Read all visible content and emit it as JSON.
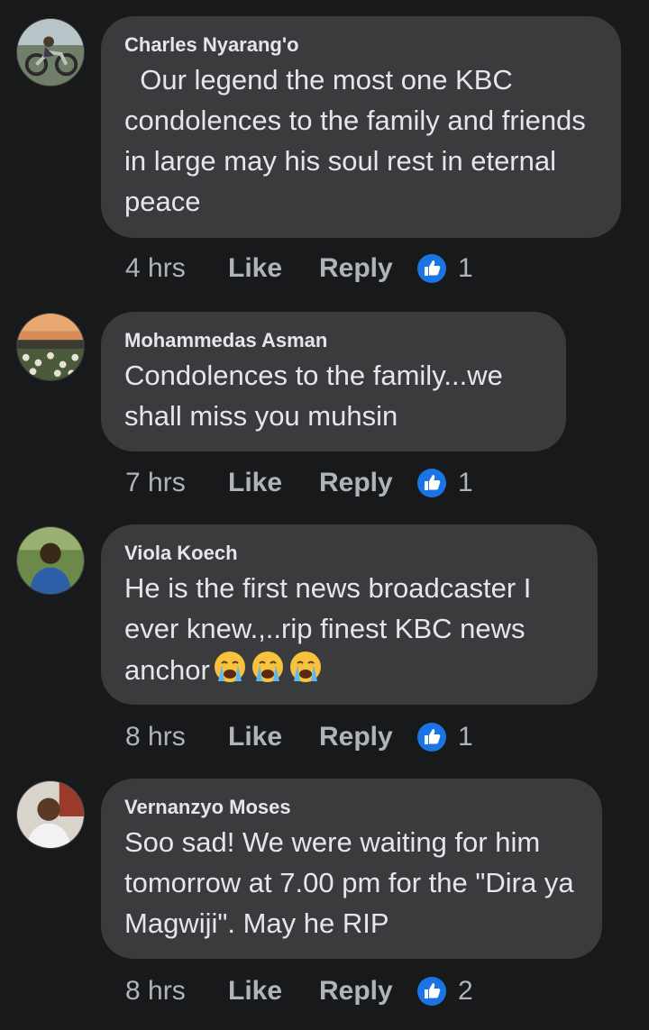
{
  "colors": {
    "background": "#18191a",
    "bubble": "#3a3b3c",
    "text": "#e4e6eb",
    "secondary_text": "#b0b3b8",
    "like_blue": "#1b74e4"
  },
  "comments": [
    {
      "author": "Charles Nyarang'o",
      "text": "  Our legend the most one KBC condolences to the family and friends in large may his soul rest in eternal peace",
      "time": "4 hrs",
      "like_label": "Like",
      "reply_label": "Reply",
      "reaction_count": "1",
      "avatar_icon": "motorcycle-avatar"
    },
    {
      "author": "Mohammedas Asman",
      "text": "Condolences to the family...we shall miss you muhsin",
      "time": "7 hrs",
      "like_label": "Like",
      "reply_label": "Reply",
      "reaction_count": "1",
      "avatar_icon": "flowers-sunset-avatar"
    },
    {
      "author": "Viola Koech",
      "text": "He is the first news broadcaster I ever knew.,..rip finest KBC news anchor",
      "emoji_count": 3,
      "emoji_icon": "loudly-crying-face-icon",
      "time": "8 hrs",
      "like_label": "Like",
      "reply_label": "Reply",
      "reaction_count": "1",
      "avatar_icon": "person-outdoors-avatar"
    },
    {
      "author": "Vernanzyo Moses",
      "text": "Soo sad! We were waiting for him tomorrow at 7.00 pm for the \"Dira ya Magwiji\". May he RIP",
      "time": "8 hrs",
      "like_label": "Like",
      "reply_label": "Reply",
      "reaction_count": "2",
      "avatar_icon": "person-portrait-avatar"
    }
  ]
}
